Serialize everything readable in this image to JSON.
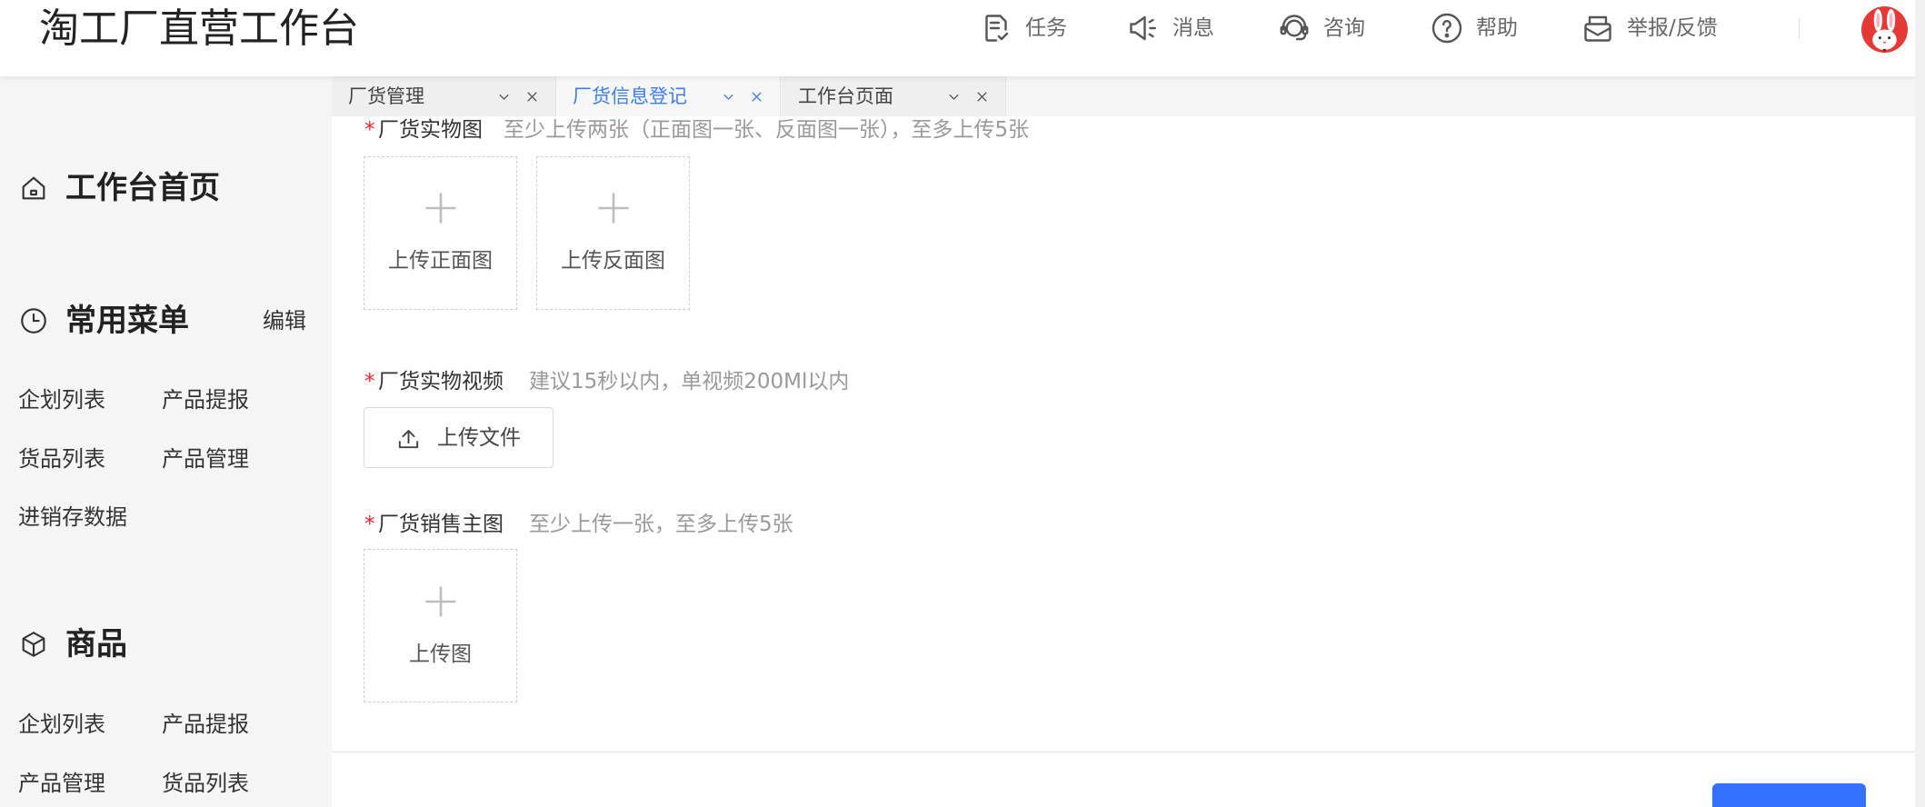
{
  "theme": {
    "accent": "#3d7cff",
    "required": "#f5222d",
    "primary": "#3370ff"
  },
  "header": {
    "title": "淘工厂直营工作台",
    "actions": [
      {
        "label": "任务",
        "icon": "task-icon"
      },
      {
        "label": "消息",
        "icon": "megaphone-icon"
      },
      {
        "label": "咨询",
        "icon": "headset-icon"
      },
      {
        "label": "帮助",
        "icon": "help-icon"
      },
      {
        "label": "举报/反馈",
        "icon": "report-icon"
      }
    ],
    "avatar_icon": "rabbit-avatar"
  },
  "tabs": [
    {
      "label": "厂货管理",
      "active": false
    },
    {
      "label": "厂货信息登记",
      "active": true
    },
    {
      "label": "工作台页面",
      "active": false
    }
  ],
  "sidebar": {
    "home": {
      "label": "工作台首页",
      "icon": "home-icon"
    },
    "common_menu": {
      "label": "常用菜单",
      "icon": "clock-icon",
      "edit_label": "编辑",
      "items": [
        "企划列表",
        "产品提报",
        "货品列表",
        "产品管理",
        "进销存数据"
      ]
    },
    "goods": {
      "label": "商品",
      "icon": "cube-icon",
      "items": [
        "企划列表",
        "产品提报",
        "产品管理",
        "货品列表"
      ]
    }
  },
  "form": {
    "required_mark": "*",
    "fields": [
      {
        "label": "厂货实物图",
        "hint": "至少上传两张（正面图一张、反面图一张），至多上传5张",
        "uploads": [
          "上传正面图",
          "上传反面图"
        ]
      },
      {
        "label": "厂货实物视频",
        "hint": "建议15秒以内，单视频200Ml以内",
        "button": "上传文件",
        "button_icon": "upload-icon"
      },
      {
        "label": "厂货销售主图",
        "hint": "至少上传一张，至多上传5张",
        "uploads": [
          "上传图"
        ]
      }
    ]
  }
}
